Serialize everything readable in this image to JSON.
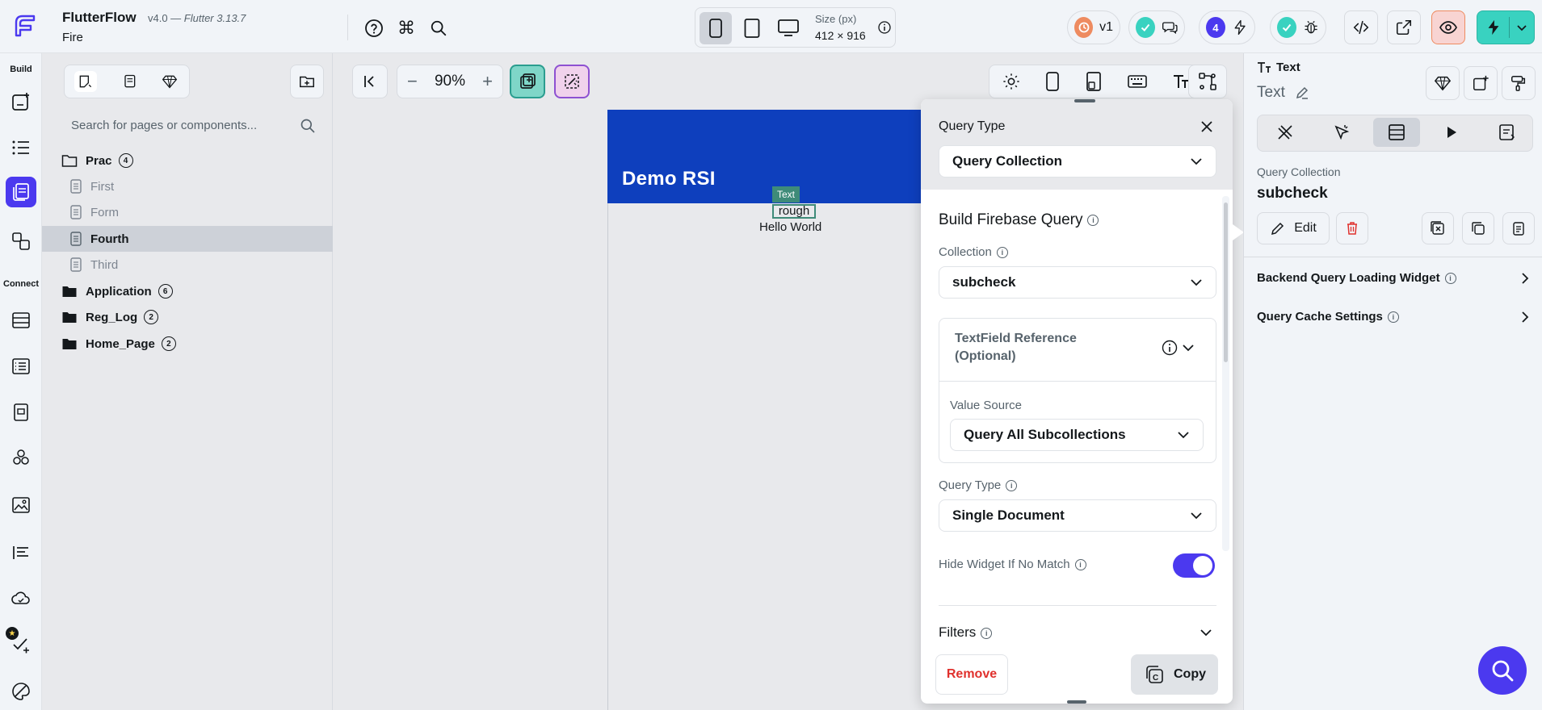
{
  "header": {
    "app_name": "FlutterFlow",
    "version": "v4.0 — ",
    "flutter_version": "Flutter 3.13.7",
    "project": "Fire",
    "size_label": "Size (px)",
    "size_value": "412 × 916",
    "branch": "v1",
    "notifications": "4"
  },
  "rail": {
    "build_label": "Build",
    "connect_label": "Connect"
  },
  "pages_panel": {
    "search_placeholder": "Search for pages or components...",
    "tree": [
      {
        "label": "Prac",
        "count": "4",
        "type": "folder-open"
      },
      {
        "label": "First",
        "type": "page"
      },
      {
        "label": "Form",
        "type": "page"
      },
      {
        "label": "Fourth",
        "type": "page",
        "selected": true
      },
      {
        "label": "Third",
        "type": "page"
      },
      {
        "label": "Application",
        "count": "6",
        "type": "folder"
      },
      {
        "label": "Reg_Log",
        "count": "2",
        "type": "folder"
      },
      {
        "label": "Home_Page",
        "count": "2",
        "type": "folder"
      }
    ]
  },
  "canvas": {
    "zoom": "90%",
    "appbar_title": "Demo RSI",
    "selected_tag": "Text",
    "selected_text": "rough",
    "hello_text": "Hello World"
  },
  "query_panel": {
    "query_type_label": "Query Type",
    "query_type_value": "Query Collection",
    "build_title": "Build Firebase Query",
    "collection_label": "Collection",
    "collection_value": "subcheck",
    "textfield_ref_label": "TextField Reference",
    "textfield_ref_optional": "(Optional)",
    "value_source_label": "Value Source",
    "value_source_value": "Query All Subcollections",
    "query_type2_label": "Query Type",
    "query_type2_value": "Single Document",
    "hide_widget_label": "Hide Widget If No Match",
    "hide_widget_on": true,
    "filters_label": "Filters",
    "remove_label": "Remove",
    "copy_label": "Copy"
  },
  "properties": {
    "widget_type": "Text",
    "widget_name": "Text",
    "query_kind": "Query Collection",
    "query_name": "subcheck",
    "edit_label": "Edit",
    "loading_widget_label": "Backend Query Loading Widget",
    "cache_label": "Query Cache Settings"
  },
  "colors": {
    "accent": "#4b39ef",
    "appbar": "#0e3fbd",
    "selection": "#3e8b79",
    "danger": "#e0312d"
  }
}
